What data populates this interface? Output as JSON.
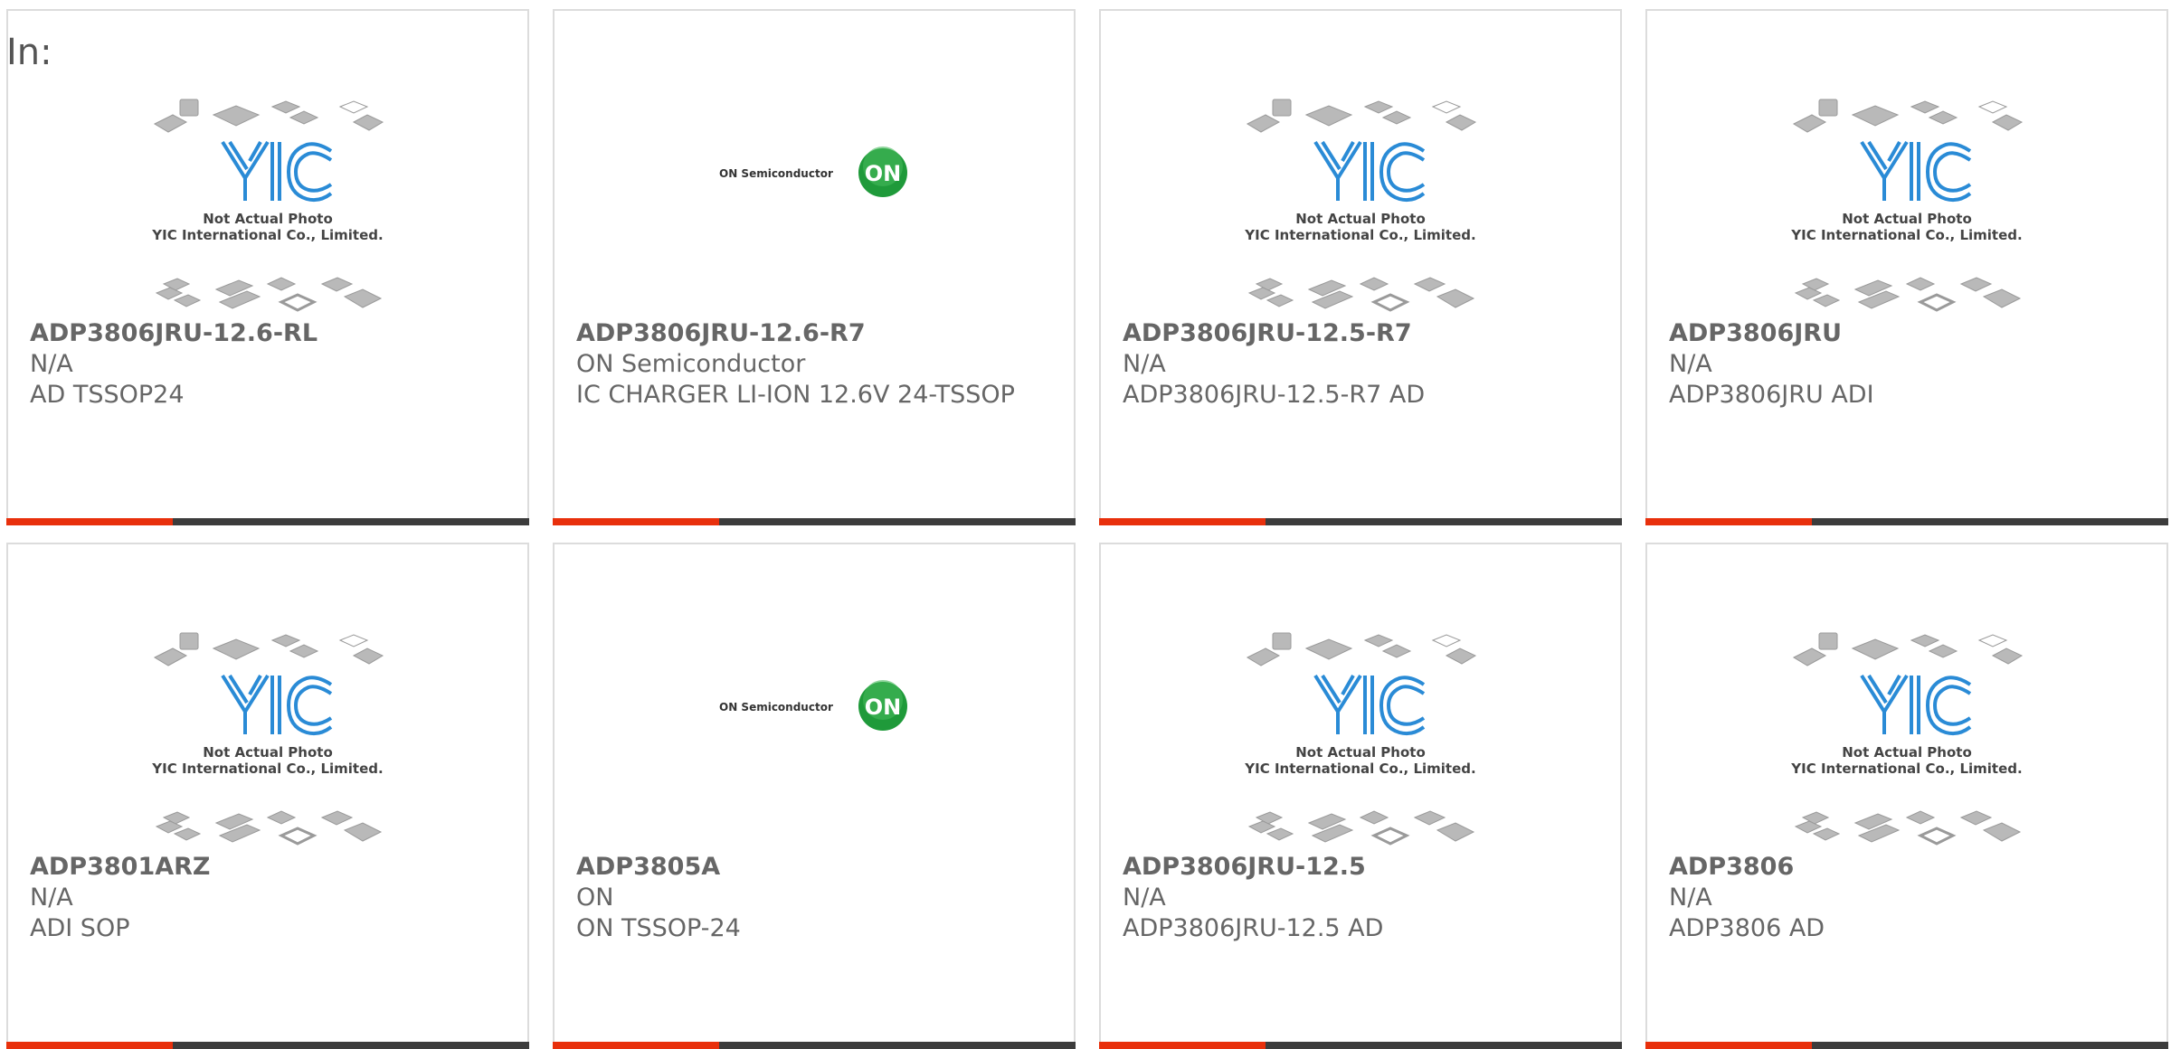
{
  "header": {
    "in_label": "In:"
  },
  "placeholder_caption": {
    "line1": "Not Actual Photo",
    "line2": "YIC International Co., Limited.",
    "logo_text": "YIC"
  },
  "on_logo": {
    "wordmark": "ON Semiconductor",
    "badge": "ON"
  },
  "colors": {
    "accent": "#e8300c",
    "bar": "#3c3c3c",
    "border": "#dcdcdc",
    "text": "#666666",
    "yic_blue": "#2a8bd6",
    "on_green": "#1f9a3a"
  },
  "products": [
    {
      "part": "ADP3806JRU-12.6-RL",
      "mfr": "N/A",
      "desc": "AD TSSOP24",
      "image": "placeholder-photo"
    },
    {
      "part": "ADP3806JRU-12.6-R7",
      "mfr": "ON Semiconductor",
      "desc": "IC CHARGER LI-ION 12.6V 24-TSSOP",
      "image": "on-semiconductor-logo"
    },
    {
      "part": "ADP3806JRU-12.5-R7",
      "mfr": "N/A",
      "desc": "ADP3806JRU-12.5-R7 AD",
      "image": "placeholder-photo"
    },
    {
      "part": "ADP3806JRU",
      "mfr": "N/A",
      "desc": "ADP3806JRU ADI",
      "image": "placeholder-photo"
    },
    {
      "part": "ADP3801ARZ",
      "mfr": "N/A",
      "desc": "ADI SOP",
      "image": "placeholder-photo"
    },
    {
      "part": "ADP3805A",
      "mfr": "ON",
      "desc": "ON TSSOP-24",
      "image": "on-semiconductor-logo"
    },
    {
      "part": "ADP3806JRU-12.5",
      "mfr": "N/A",
      "desc": "ADP3806JRU-12.5 AD",
      "image": "placeholder-photo"
    },
    {
      "part": "ADP3806",
      "mfr": "N/A",
      "desc": "ADP3806 AD",
      "image": "placeholder-photo"
    }
  ]
}
